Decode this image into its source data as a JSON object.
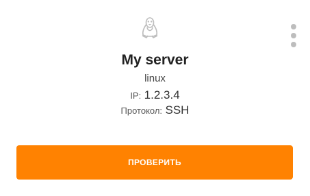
{
  "server": {
    "os_icon": "linux-penguin-icon",
    "name": "My server",
    "os": "linux",
    "ip_label": "IP:",
    "ip_value": "1.2.3.4",
    "protocol_label": "Протокол:",
    "protocol_value": "SSH"
  },
  "menu": {
    "icon": "kebab-menu-icon"
  },
  "actions": {
    "check_label": "ПРОВЕРИТЬ"
  },
  "colors": {
    "accent": "#ff8201",
    "icon_gray": "#bdbdbd",
    "title": "#222222"
  }
}
